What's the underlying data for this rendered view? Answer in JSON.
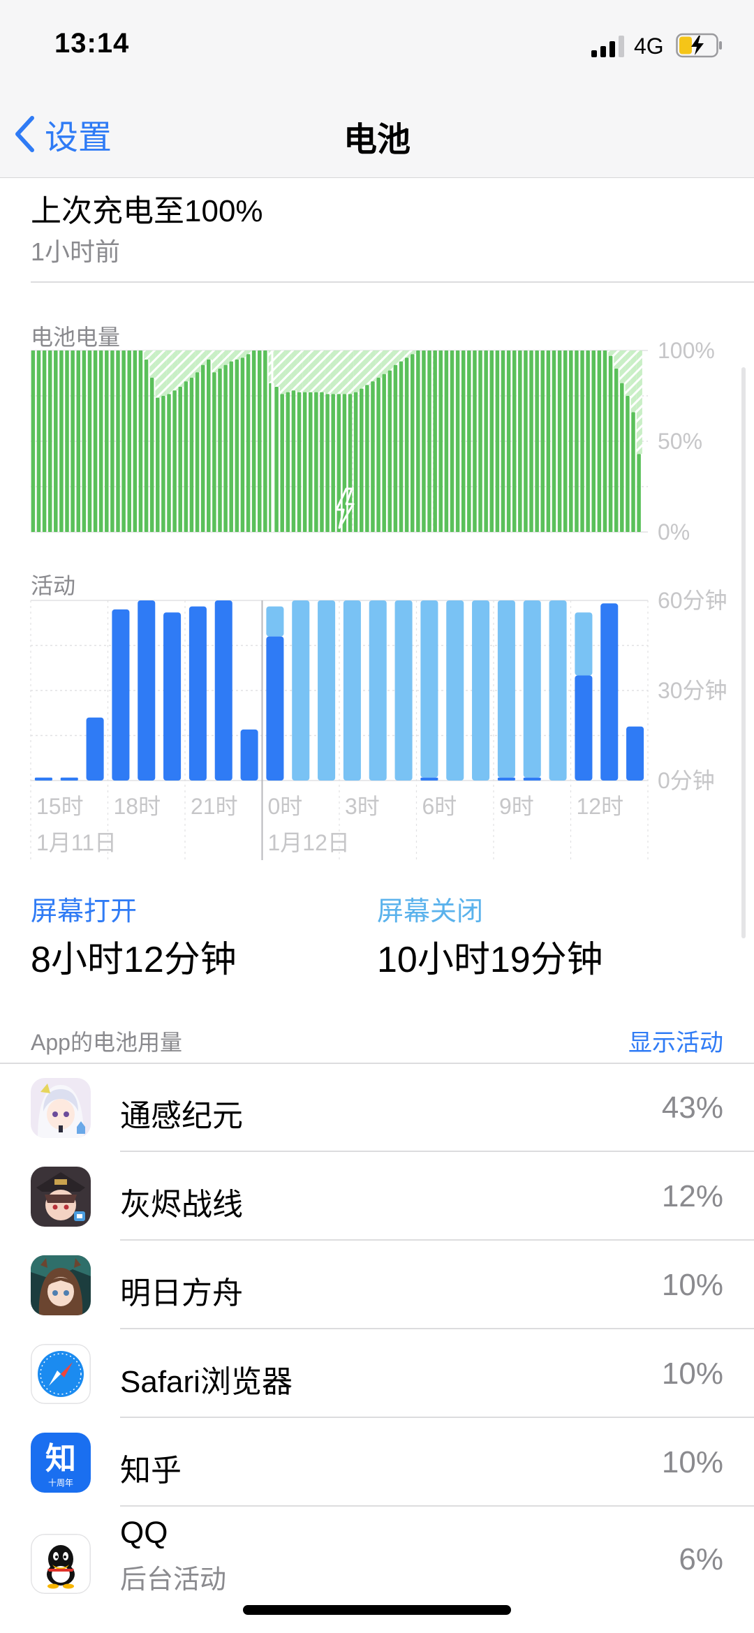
{
  "status": {
    "time": "13:14",
    "network": "4G"
  },
  "nav": {
    "back_label": "设置",
    "title": "电池"
  },
  "last_charge": {
    "title": "上次充电至100%",
    "subtitle": "1小时前"
  },
  "battery_chart_label": "电池电量",
  "activity_chart_label": "活动",
  "chart_data": [
    {
      "type": "bar",
      "title": "电池电量",
      "y_ticks": [
        "100%",
        "50%",
        "0%"
      ],
      "ylim": [
        0,
        100
      ],
      "values": [
        100,
        100,
        100,
        100,
        100,
        100,
        100,
        100,
        100,
        100,
        100,
        100,
        100,
        100,
        100,
        100,
        100,
        100,
        100,
        100,
        95,
        85,
        74,
        75,
        76,
        78,
        80,
        83,
        85,
        88,
        92,
        95,
        88,
        90,
        92,
        94,
        95,
        96,
        98,
        100,
        100,
        100,
        82,
        80,
        76,
        77,
        78,
        77,
        77,
        77,
        77,
        77,
        76,
        76,
        76,
        76,
        76,
        77,
        79,
        81,
        83,
        85,
        87,
        89,
        92,
        94,
        96,
        98,
        100,
        100,
        100,
        100,
        100,
        100,
        100,
        100,
        100,
        100,
        100,
        100,
        100,
        100,
        100,
        100,
        100,
        100,
        100,
        100,
        100,
        100,
        100,
        100,
        100,
        100,
        100,
        100,
        100,
        100,
        100,
        100,
        100,
        100,
        97,
        90,
        82,
        75,
        66,
        43
      ],
      "ghost_to_100": true,
      "charging_icon": "lightning-icon",
      "colors": {
        "level": "#5ac05a",
        "stripe": "#ffffff",
        "ghost": "#c9efc6"
      }
    },
    {
      "type": "bar",
      "title": "活动",
      "y_ticks": [
        "60分钟",
        "30分钟",
        "0分钟"
      ],
      "ylim": [
        0,
        60
      ],
      "categories": [
        "15时",
        "16时",
        "17时",
        "18时",
        "19时",
        "20时",
        "21时",
        "22时",
        "23时",
        "0时",
        "1时",
        "2时",
        "3时",
        "4时",
        "5时",
        "6时",
        "7时",
        "8时",
        "9时",
        "10时",
        "11时",
        "12时",
        "13时"
      ],
      "x_tick_labels": [
        "15时",
        "18时",
        "21时",
        "0时",
        "3时",
        "6时",
        "9时",
        "12时"
      ],
      "date_labels": [
        "1月11日",
        "1月12日"
      ],
      "series": [
        {
          "name": "屏幕打开",
          "values": [
            1,
            1,
            21,
            57,
            60,
            56,
            58,
            60,
            17,
            48,
            0,
            0,
            0,
            0,
            0,
            1,
            0,
            0,
            1,
            1,
            0,
            35,
            59,
            18
          ]
        },
        {
          "name": "屏幕关闭",
          "values": [
            0,
            0,
            0,
            0,
            0,
            0,
            0,
            0,
            0,
            10,
            60,
            60,
            60,
            60,
            60,
            59,
            60,
            60,
            59,
            59,
            60,
            21,
            0,
            0
          ]
        }
      ],
      "colors": {
        "on": "#2f7bf5",
        "off": "#79c2f4"
      }
    }
  ],
  "legend": {
    "screen_on_label": "屏幕打开",
    "screen_on_value": "8小时12分钟",
    "screen_off_label": "屏幕关闭",
    "screen_off_value": "10小时19分钟"
  },
  "usage": {
    "header": "App的电池用量",
    "show_activity": "显示活动",
    "apps": [
      {
        "name": "通感纪元",
        "percent": "43%",
        "sub": ""
      },
      {
        "name": "灰烬战线",
        "percent": "12%",
        "sub": ""
      },
      {
        "name": "明日方舟",
        "percent": "10%",
        "sub": ""
      },
      {
        "name": "Safari浏览器",
        "percent": "10%",
        "sub": ""
      },
      {
        "name": "知乎",
        "percent": "10%",
        "sub": ""
      },
      {
        "name": "QQ",
        "percent": "6%",
        "sub": "后台活动"
      }
    ]
  },
  "zhihu_icon": {
    "glyph": "知",
    "caption": "十周年"
  }
}
